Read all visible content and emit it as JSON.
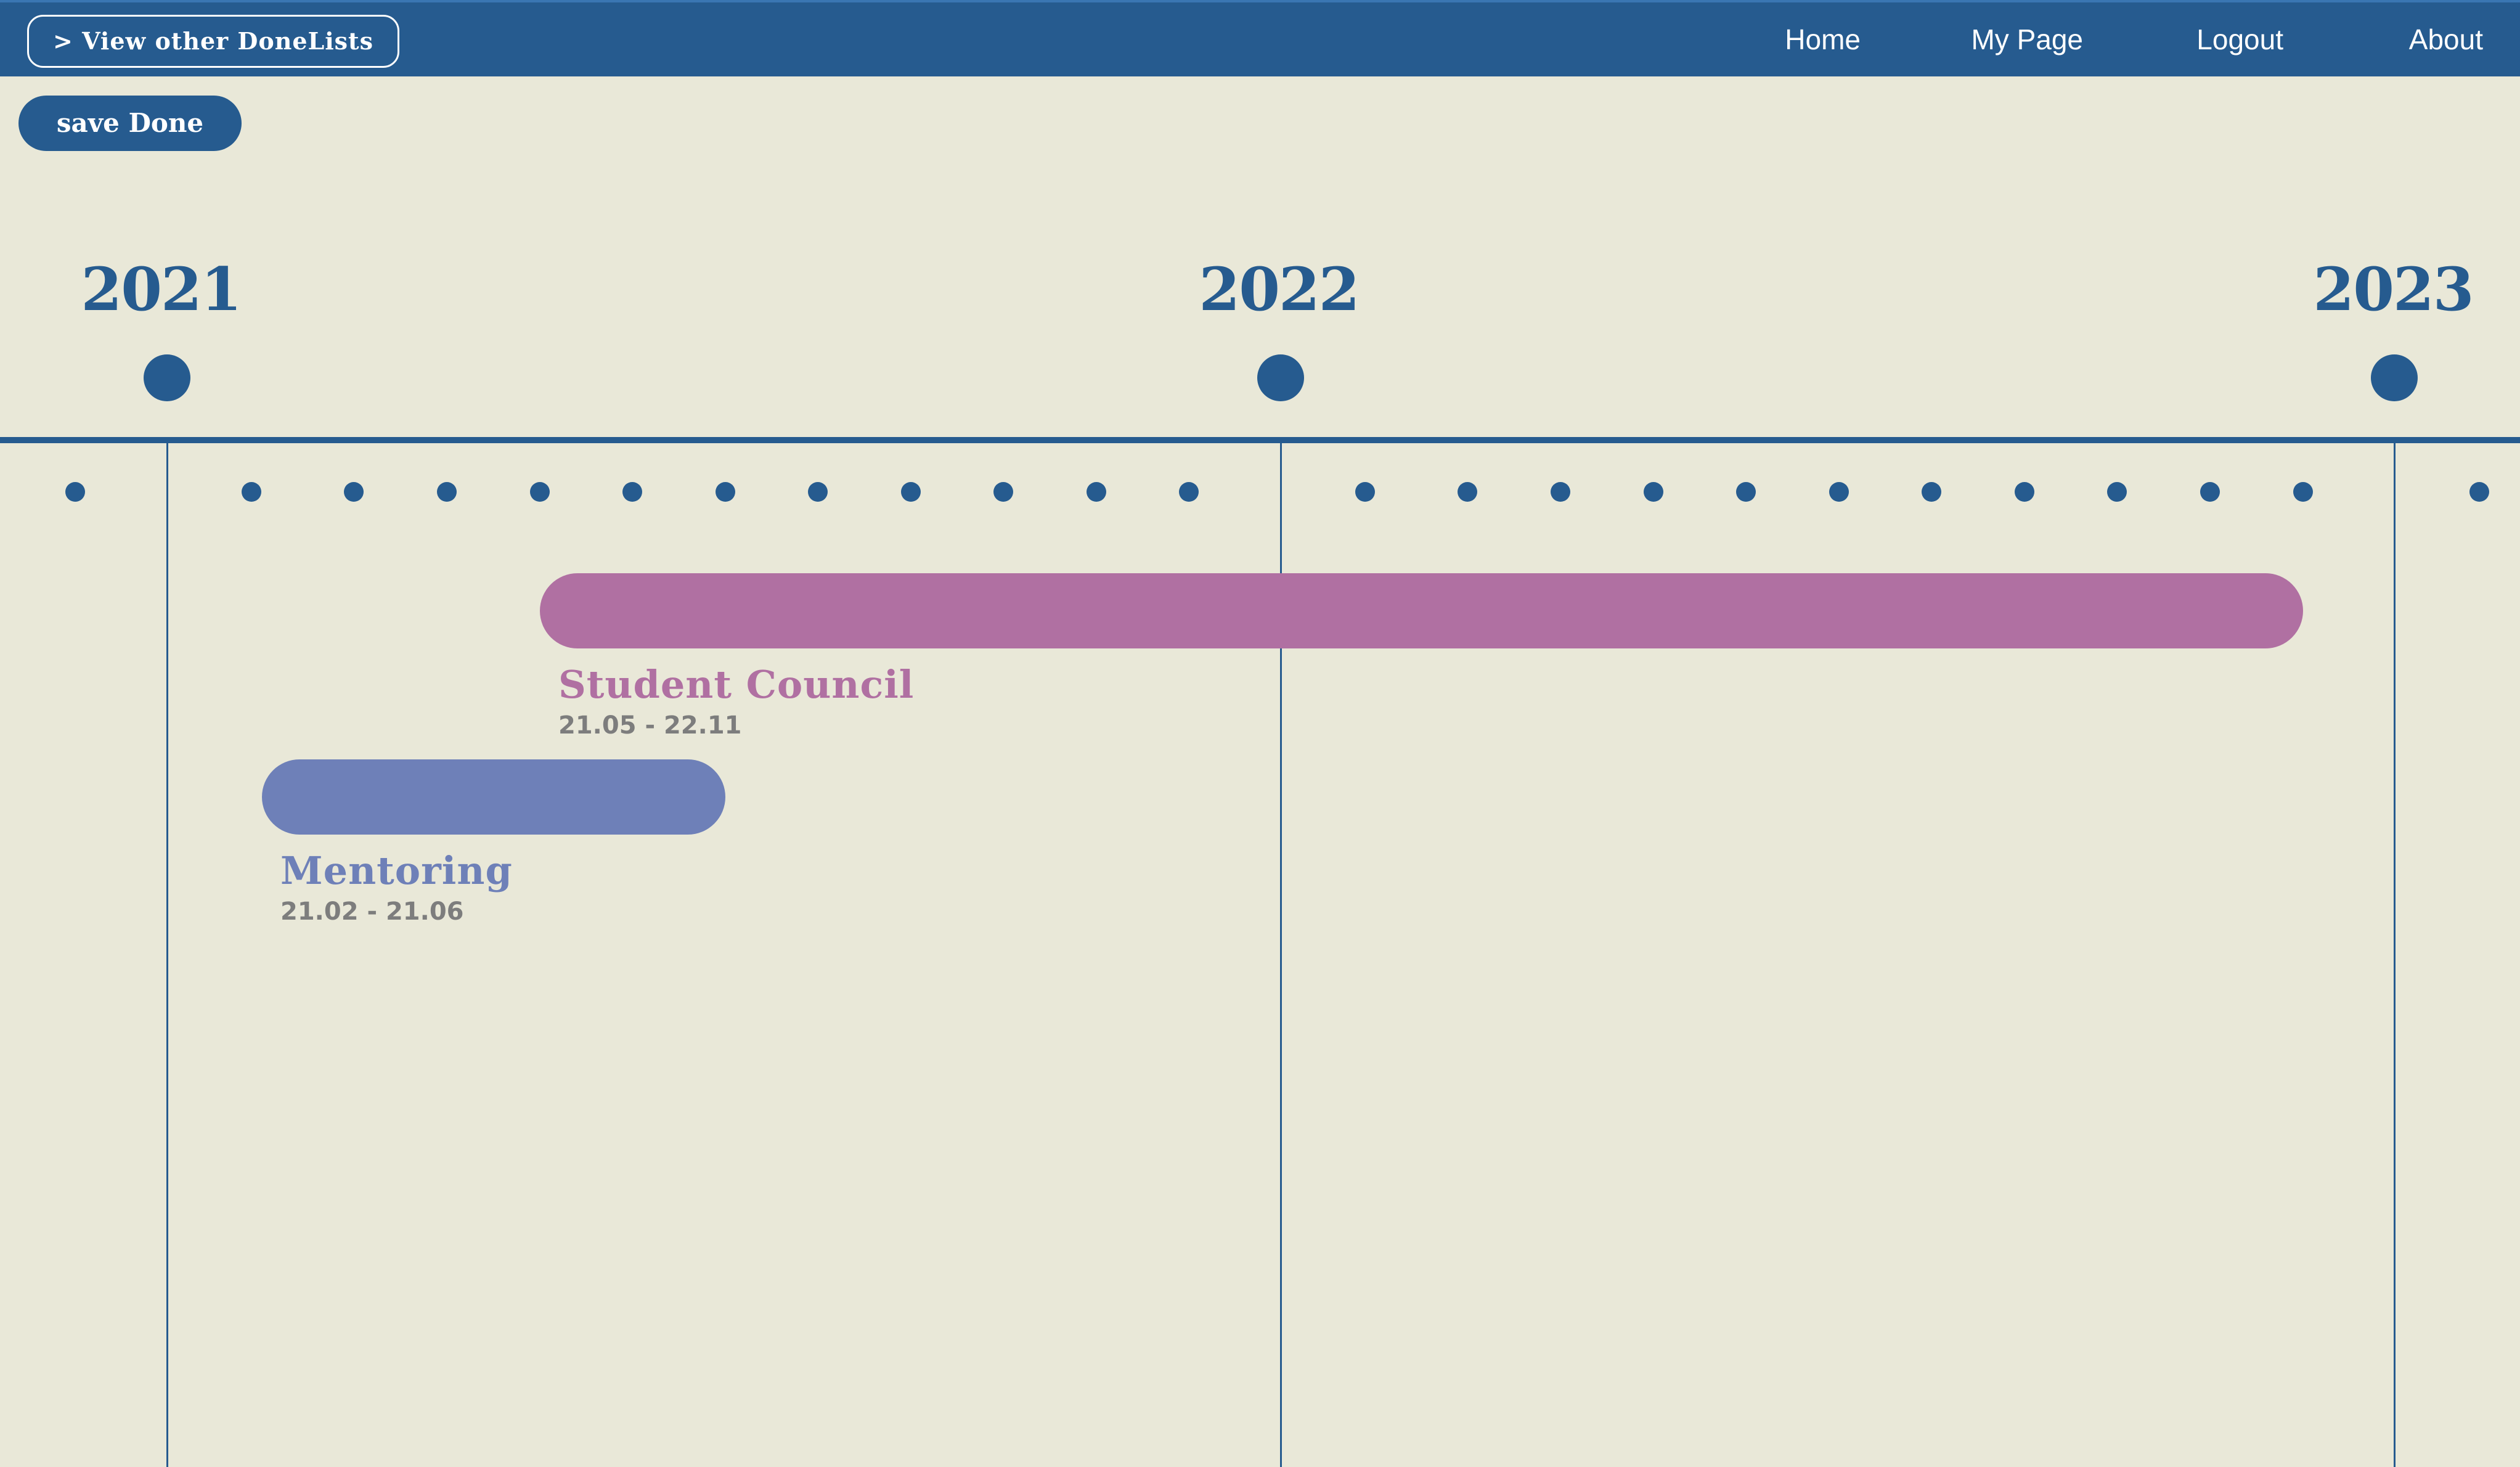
{
  "navbar": {
    "other_lists_label": "> View other DoneLists",
    "links": [
      "Home",
      "My Page",
      "Logout",
      "About"
    ]
  },
  "toolbar": {
    "save_label": "save Done"
  },
  "timeline": {
    "years": [
      "2021",
      "2022",
      "2023"
    ]
  },
  "dones": [
    {
      "title": "Student Council",
      "range": "21.05 - 22.11",
      "color": "#b070a2"
    },
    {
      "title": "Mentoring",
      "range": "21.02 - 21.06",
      "color": "#6e80b8"
    }
  ],
  "colors": {
    "primary": "#265b8f",
    "background": "#e9e8d8",
    "date_text": "#7d7d7d",
    "nav_text": "#ffffff"
  }
}
